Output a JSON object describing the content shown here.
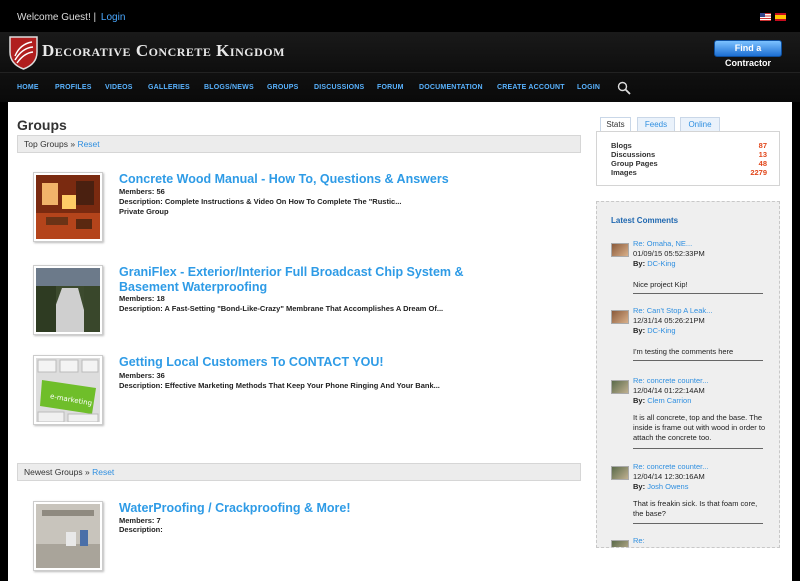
{
  "topbar": {
    "welcome": "Welcome Guest!",
    "separator": "|",
    "login": "Login"
  },
  "header": {
    "logo_text": "Decorative Concrete Kingdom",
    "find_contractor": "Find a Contractor"
  },
  "nav": [
    "HOME",
    "PROFILES",
    "VIDEOS",
    "GALLERIES",
    "BLOGS/NEWS",
    "GROUPS",
    "DISCUSSIONS",
    "FORUM",
    "DOCUMENTATION",
    "CREATE ACCOUNT",
    "LOGIN"
  ],
  "page": {
    "title": "Groups"
  },
  "top_groups": {
    "label": "Top Groups",
    "sep": "»",
    "reset": "Reset",
    "items": [
      {
        "title": "Concrete Wood Manual - How To, Questions & Answers",
        "members": "Members: 56",
        "description": "Description: Complete Instructions & Video On How To Complete The \"Rustic...",
        "privacy": "Private Group"
      },
      {
        "title": "GraniFlex - Exterior/Interior Full Broadcast Chip System & Basement Waterproofing",
        "members": "Members: 18",
        "description": "Description: A Fast-Setting \"Bond-Like-Crazy\" Membrane That Accomplishes A Dream Of..."
      },
      {
        "title": "Getting Local Customers To CONTACT YOU!",
        "members": "Members: 36",
        "description": "Description: Effective Marketing Methods That Keep Your Phone Ringing And Your Bank...",
        "thumb_text": "e-marketing"
      }
    ]
  },
  "newest_groups": {
    "label": "Newest Groups",
    "sep": "»",
    "reset": "Reset",
    "items": [
      {
        "title": "WaterProofing / Crackproofing & More!",
        "members": "Members: 7",
        "description": "Description:"
      }
    ]
  },
  "sidebar": {
    "tabs": [
      "Stats",
      "Feeds",
      "Online"
    ],
    "stats": [
      {
        "label": "Blogs",
        "value": "87"
      },
      {
        "label": "Discussions",
        "value": "13"
      },
      {
        "label": "Group Pages",
        "value": "48"
      },
      {
        "label": "Images",
        "value": "2279"
      }
    ],
    "comments_title": "Latest Comments",
    "by_label": "By:",
    "comments": [
      {
        "title": "Re: Omaha, NE...",
        "date": "01/09/15 05:52:33PM",
        "author": "DC-King",
        "body": "Nice project Kip!"
      },
      {
        "title": "Re: Can't Stop A Leak...",
        "date": "12/31/14 05:26:21PM",
        "author": "DC-King",
        "body": "I'm testing the comments here"
      },
      {
        "title": "Re: concrete counter...",
        "date": "12/04/14 01:22:14AM",
        "author": "Clem Carrion",
        "body": "It is all concrete, top and the base. The inside is frame out with wood in order to attach the concrete too."
      },
      {
        "title": "Re: concrete counter...",
        "date": "12/04/14 12:30:16AM",
        "author": "Josh Owens",
        "body": "That is freakin sick. Is that foam core, the base?"
      }
    ],
    "partial_comment": "Re:"
  },
  "colors": {
    "link": "#2e9be6",
    "stat_value": "#e2471b",
    "nav": "#59b3ff"
  }
}
